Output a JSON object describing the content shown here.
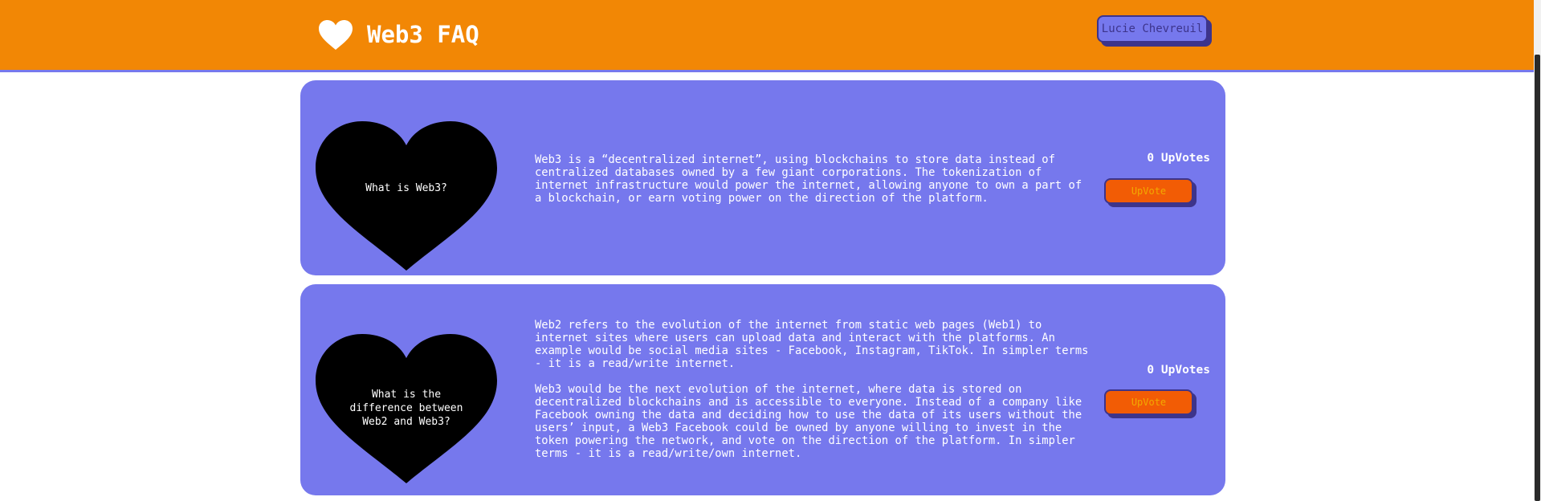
{
  "colors": {
    "header_bg": "#f28705",
    "accent_purple": "#7678ed",
    "dark_purple": "#3d348b",
    "upvote_button": "#f25c05",
    "upvote_text": "#f2a900",
    "heart": "#000000"
  },
  "header": {
    "logo_icon": "heart-icon",
    "title": "Web3 FAQ",
    "user_name": "Lucie Chevreuil"
  },
  "faqs": [
    {
      "question": "What is Web3?",
      "answer_paragraphs": [
        "Web3 is a “decentralized internet”, using blockchains to store data instead of centralized databases owned by a few giant corporations. The tokenization of internet infrastructure would power the internet, allowing anyone to own a part of a blockchain, or earn voting power on the direction of the platform."
      ],
      "votes_label": "0 UpVotes",
      "upvote_label": "UpVote"
    },
    {
      "question": "What is the difference between Web2 and Web3?",
      "answer_paragraphs": [
        "Web2 refers to the evolution of the internet from static web pages (Web1) to internet sites where users can upload data and interact with the platforms. An example would be social media sites - Facebook, Instagram, TikTok. In simpler terms - it is a read/write internet.",
        "Web3 would be the next evolution of the internet, where data is stored on decentralized blockchains and is accessible to everyone. Instead of a company like Facebook owning the data and deciding how to use the data of its users without the users’ input, a Web3 Facebook could be owned by anyone willing to invest in the token powering the network, and vote on the direction of the platform. In simpler terms - it is a read/write/own internet."
      ],
      "votes_label": "0 UpVotes",
      "upvote_label": "UpVote"
    }
  ]
}
